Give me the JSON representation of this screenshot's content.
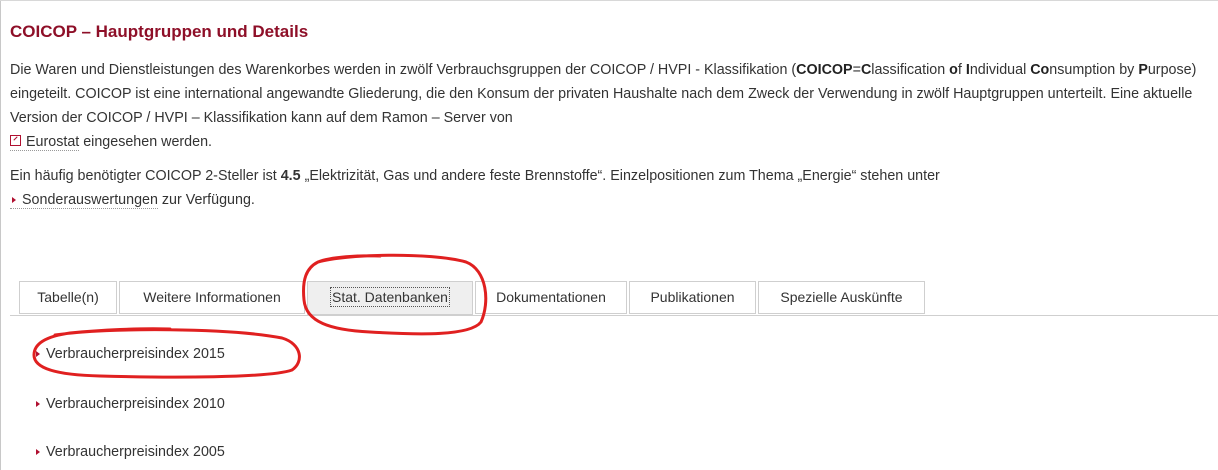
{
  "page": {
    "title": "COICOP – Hauptgruppen und Details",
    "intro": {
      "t1": "Die Waren und Dienstleistungen des Warenkorbes werden in zwölf Verbrauchsgruppen der COICOP / HVPI - Klassifikation (",
      "b1": "COICOP",
      "t2": "=",
      "b2": "C",
      "t3": "lassification ",
      "b3": "o",
      "t4": "f",
      "b4": "I",
      "t5": "ndividual ",
      "b5": "Co",
      "t6": "nsumption by ",
      "b6": "P",
      "t7": "urpose) eingeteilt. COICOP ist eine international angewandte Gliederung, die den Konsum der privaten Haushalte nach dem Zweck der Verwendung in zwölf Hauptgruppen unterteilt. Eine aktuelle Version der COICOP / HVPI – Klassifikation kann auf dem Ramon – Server von ",
      "link": "Eurostat",
      "t8": " eingesehen werden."
    },
    "hint": {
      "t1": "Ein häufig benötigter COICOP 2-Steller ist ",
      "bold": "4.5",
      "t2": " „Elektrizität, Gas und andere feste Brennstoffe“. Einzelpositionen zum Thema „Energie“ stehen unter",
      "link": "Sonderauswertungen",
      "t3": " zur Verfügung."
    }
  },
  "tabs": [
    {
      "label": "Tabelle(n)"
    },
    {
      "label": "Weitere Informationen"
    },
    {
      "label": "Stat. Datenbanken"
    },
    {
      "label": "Dokumentationen"
    },
    {
      "label": "Publikationen"
    },
    {
      "label": "Spezielle Auskünfte"
    }
  ],
  "active_tab": "Stat. Datenbanken",
  "list": [
    {
      "label": "Verbraucherpreisindex 2015"
    },
    {
      "label": "Verbraucherpreisindex 2010"
    },
    {
      "label": "Verbraucherpreisindex 2005"
    }
  ],
  "colors": {
    "title": "#8e0f28",
    "accent": "#b01030",
    "annotation": "#e02020"
  },
  "icons": {
    "external_link": "external-link-icon",
    "arrow": "caret-right-icon"
  }
}
